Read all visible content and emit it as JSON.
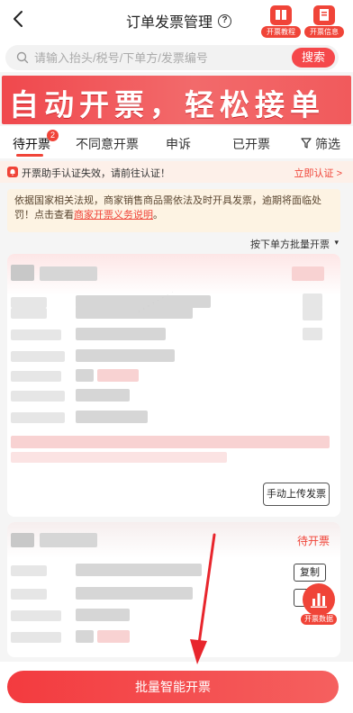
{
  "header": {
    "title": "订单发票管理",
    "help_glyph": "?",
    "btn_tutorial": "开票教程",
    "btn_info": "开票信息"
  },
  "search": {
    "placeholder": "请输入抬头/税号/下单方/发票编号",
    "button": "搜索"
  },
  "banner": {
    "text": "自动开票，轻松接单"
  },
  "tabs": [
    {
      "label": "待开票",
      "badge": "2",
      "active": true
    },
    {
      "label": "不同意开票"
    },
    {
      "label": "申诉"
    },
    {
      "label": "已开票"
    },
    {
      "label": "筛选"
    }
  ],
  "notice": {
    "text": "开票助手认证失效，请前往认证！",
    "link": "立即认证 >"
  },
  "info": {
    "text": "依据国家相关法规，商家销售商品需依法及时开具发票，逾期将面临处罚！点击查看",
    "link": "商家开票义务说明",
    "tail": "。"
  },
  "batch": {
    "label": "按下单方批量开票",
    "chevron": "▾"
  },
  "card1": {
    "upload_button": "手动上传发票"
  },
  "card2": {
    "status": "待开票",
    "copy_button": "复制"
  },
  "float": {
    "label": "开票数据"
  },
  "bottom": {
    "cta": "批量智能开票"
  },
  "colors": {
    "accent": "#f04438",
    "banner": "#f0484d",
    "notice_bg": "#fdf0e9",
    "info_bg": "#fdf3e3"
  }
}
